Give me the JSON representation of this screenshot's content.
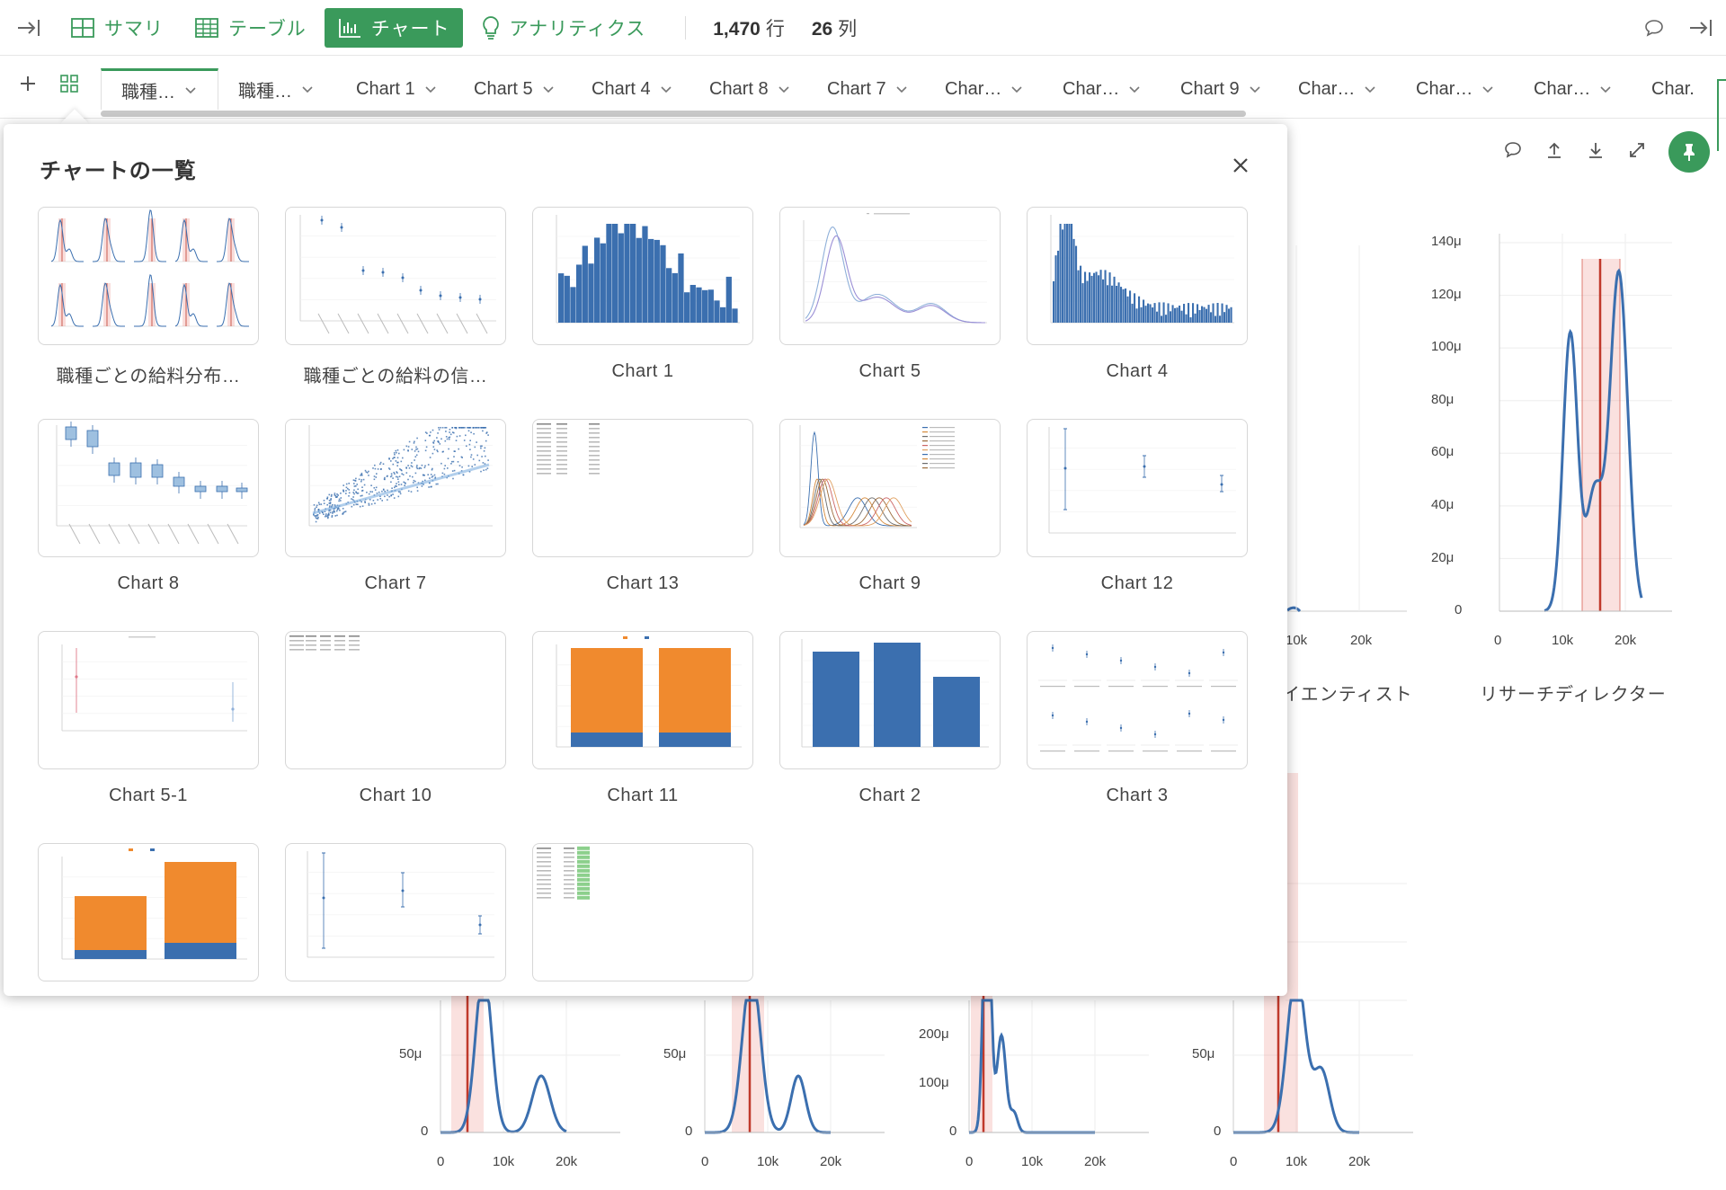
{
  "colors": {
    "accent": "#3a9a5b",
    "bar_blue": "#3b6faf",
    "bar_orange": "#f08a2e",
    "band_red": "#c0392b"
  },
  "topbar": {
    "modes": [
      {
        "label": "サマリ",
        "icon": "summary-icon",
        "active": false
      },
      {
        "label": "テーブル",
        "icon": "table-icon",
        "active": false
      },
      {
        "label": "チャート",
        "icon": "chart-icon",
        "active": true
      },
      {
        "label": "アナリティクス",
        "icon": "lightbulb-icon",
        "active": false
      }
    ],
    "rows": {
      "value": "1,470",
      "unit": "行"
    },
    "cols": {
      "value": "26",
      "unit": "列"
    }
  },
  "tabs": [
    {
      "label": "職種…",
      "active": true
    },
    {
      "label": "職種…",
      "active": false
    },
    {
      "label": "Chart 1",
      "active": false
    },
    {
      "label": "Chart 5",
      "active": false
    },
    {
      "label": "Chart 4",
      "active": false
    },
    {
      "label": "Chart 8",
      "active": false
    },
    {
      "label": "Chart 7",
      "active": false
    },
    {
      "label": "Char…",
      "active": false
    },
    {
      "label": "Char…",
      "active": false
    },
    {
      "label": "Chart 9",
      "active": false
    },
    {
      "label": "Char…",
      "active": false
    },
    {
      "label": "Char…",
      "active": false
    },
    {
      "label": "Char…",
      "active": false
    },
    {
      "label": "Char.",
      "active": false
    }
  ],
  "popup": {
    "title": "チャートの一覧",
    "charts": [
      {
        "label": "職種ごとの給料分布…",
        "kind": "facet-density"
      },
      {
        "label": "職種ごとの給料の信…",
        "kind": "errorbar-dots"
      },
      {
        "label": "Chart 1",
        "kind": "histogram"
      },
      {
        "label": "Chart 5",
        "kind": "density-two"
      },
      {
        "label": "Chart 4",
        "kind": "histogram-dense"
      },
      {
        "label": "Chart 8",
        "kind": "boxplot"
      },
      {
        "label": "Chart 7",
        "kind": "scatter"
      },
      {
        "label": "Chart 13",
        "kind": "table-small"
      },
      {
        "label": "Chart 9",
        "kind": "density-multi"
      },
      {
        "label": "Chart 12",
        "kind": "errorbar-three"
      },
      {
        "label": "Chart 5-1",
        "kind": "errorbar-two"
      },
      {
        "label": "Chart 10",
        "kind": "table-wide"
      },
      {
        "label": "Chart 11",
        "kind": "stacked-100"
      },
      {
        "label": "Chart 2",
        "kind": "bar-three"
      },
      {
        "label": "Chart 3",
        "kind": "facet-errorbar"
      },
      {
        "label": "",
        "kind": "stacked-two"
      },
      {
        "label": "",
        "kind": "errorbar-three-b"
      },
      {
        "label": "",
        "kind": "table-green"
      }
    ]
  },
  "background": {
    "right_facet": {
      "title": "リサーチディレクター",
      "yticks": [
        "140μ",
        "120μ",
        "100μ",
        "80μ",
        "60μ",
        "40μ",
        "20μ",
        "0"
      ],
      "xticks": [
        "0",
        "10k",
        "20k"
      ]
    },
    "partial_facet": {
      "title": "イエンティスト",
      "xticks": [
        "10k",
        "20k"
      ]
    },
    "bottom_facets": [
      {
        "ytick_top": "50μ",
        "ytick_zero": "0",
        "xticks": [
          "0",
          "10k",
          "20k"
        ]
      },
      {
        "ytick_top": "50μ",
        "ytick_zero": "0",
        "xticks": [
          "0",
          "10k",
          "20k"
        ]
      },
      {
        "ytick_top": "200μ",
        "ytick_mid": "100μ",
        "ytick_zero": "0",
        "xticks": [
          "0",
          "10k",
          "20k"
        ]
      },
      {
        "ytick_top": "50μ",
        "ytick_zero": "0",
        "xticks": [
          "0",
          "10k",
          "20k"
        ]
      }
    ]
  }
}
